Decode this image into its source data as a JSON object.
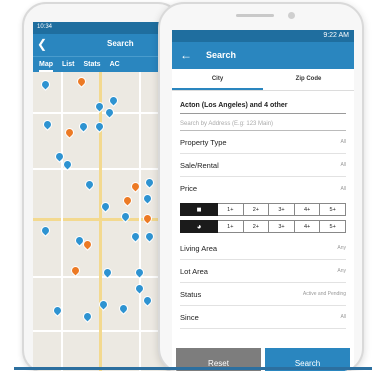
{
  "back_phone": {
    "time": "10:34",
    "title": "Search",
    "tabs": [
      "Map",
      "List",
      "Stats",
      "AC"
    ]
  },
  "front_phone": {
    "status_time": "9:22 AM",
    "header_title": "Search",
    "tabs": [
      "City",
      "Zip Code"
    ],
    "area_selected": "Acton (Los Angeles) and 4 other",
    "address_placeholder": "Search by Address (E.g: 123 Main)",
    "filters": {
      "property_type": {
        "label": "Property Type",
        "value": "All"
      },
      "sale_rental": {
        "label": "Sale/Rental",
        "value": "All"
      },
      "price": {
        "label": "Price",
        "value": "All"
      },
      "living_area": {
        "label": "Living Area",
        "value": "Any"
      },
      "lot_area": {
        "label": "Lot Area",
        "value": "Any"
      },
      "status": {
        "label": "Status",
        "value": "Active and Pending"
      },
      "since": {
        "label": "Since",
        "value": "All"
      }
    },
    "bed_options": [
      "1+",
      "2+",
      "3+",
      "4+",
      "5+"
    ],
    "bath_options": [
      "1+",
      "2+",
      "3+",
      "4+",
      "5+"
    ],
    "buttons": {
      "reset": "Reset",
      "search": "Search"
    }
  },
  "colors": {
    "primary": "#2a86bf",
    "reset": "#7d7d7d",
    "pin_blue": "#2e93d1",
    "pin_orange": "#ec7a25"
  }
}
